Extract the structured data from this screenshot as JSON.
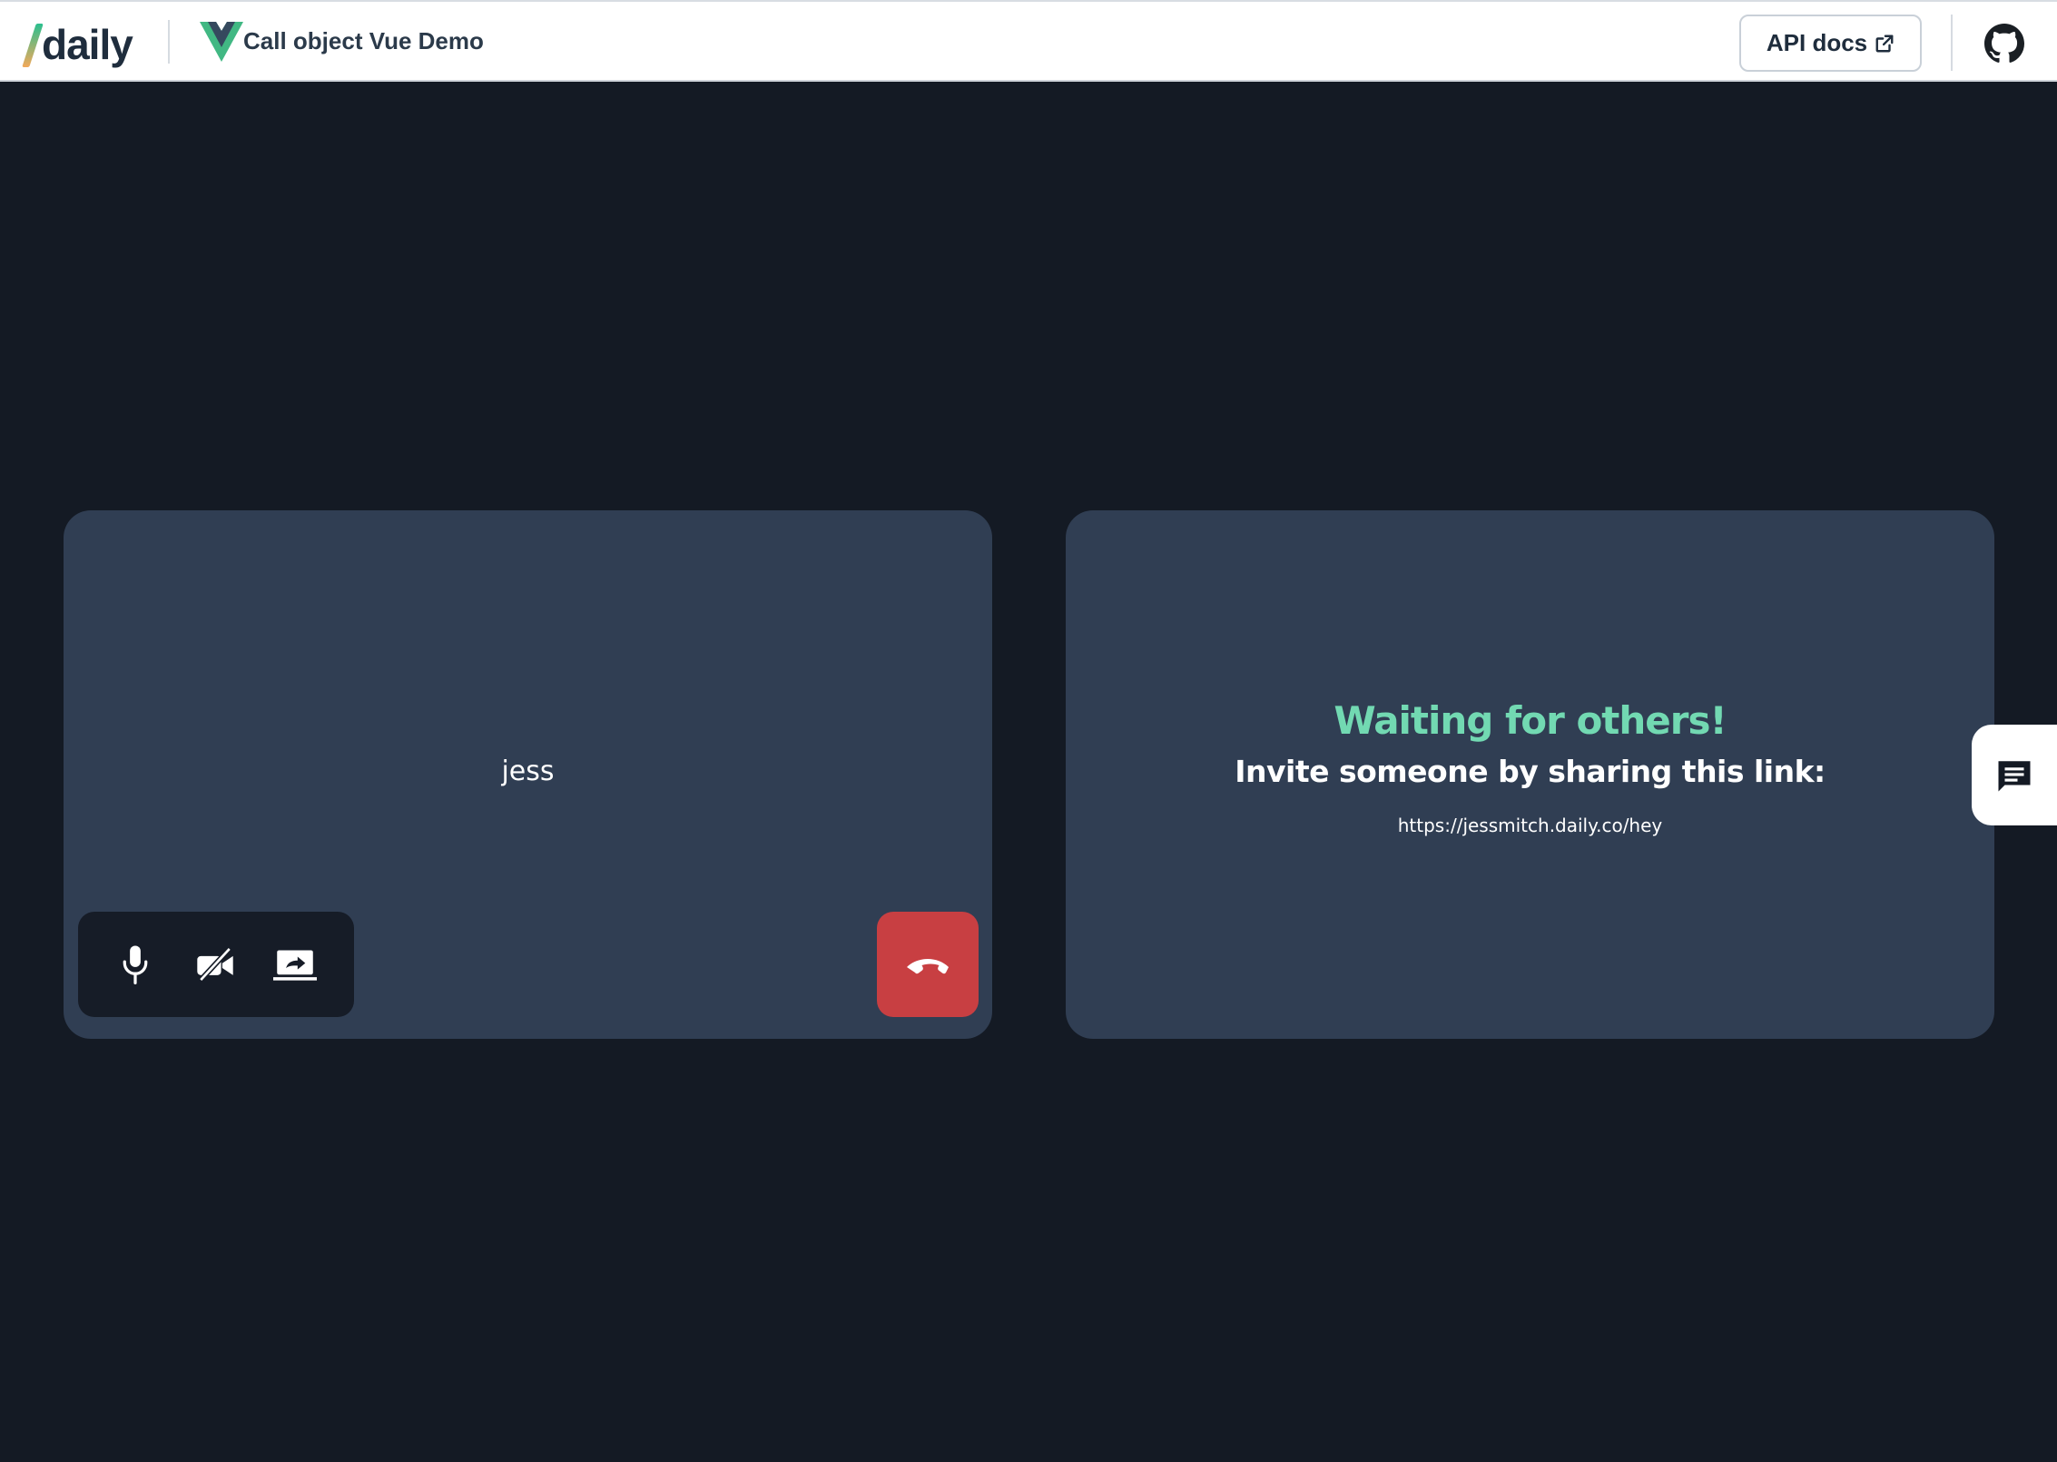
{
  "header": {
    "logo_text": "daily",
    "demo_title": "Call object Vue Demo",
    "api_docs_label": "API docs"
  },
  "icons": {
    "logo": "daily-logo",
    "vue": "vue-logo-icon",
    "external": "external-link-icon",
    "github": "github-icon",
    "mic": "microphone-icon",
    "camera": "camera-off-icon",
    "share": "screen-share-icon",
    "leave": "hang-up-icon",
    "chat": "chat-icon"
  },
  "local_tile": {
    "participant_name": "jess"
  },
  "waiting_tile": {
    "title": "Waiting for others!",
    "subtitle": "Invite someone by sharing this link:",
    "link": "https://jessmitch.daily.co/hey"
  },
  "colors": {
    "background": "#141a24",
    "tile": "#303e53",
    "controls": "#161c27",
    "leave": "#c83f42",
    "accent": "#72d9b2"
  }
}
